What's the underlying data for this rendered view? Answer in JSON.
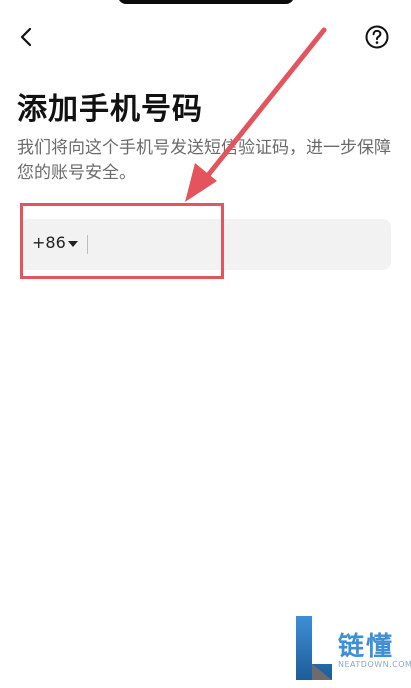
{
  "header": {
    "back_icon": "chevron-left-icon",
    "help_icon": "question-circle-icon"
  },
  "main": {
    "title": "添加手机号码",
    "description": "我们将向这个手机号发送短信验证码，进一步保障您的账号安全。",
    "phone_field": {
      "country_code": "+86",
      "value": "",
      "placeholder": ""
    }
  },
  "annotation": {
    "color": "#e4545c"
  },
  "watermark": {
    "brand": "链懂",
    "site": "NEATDOWN.COM"
  },
  "colors": {
    "title": "#111111",
    "description": "#6b6b6b",
    "field_bg": "#f2f2f2",
    "watermark_blue": "#3e8fd6"
  }
}
